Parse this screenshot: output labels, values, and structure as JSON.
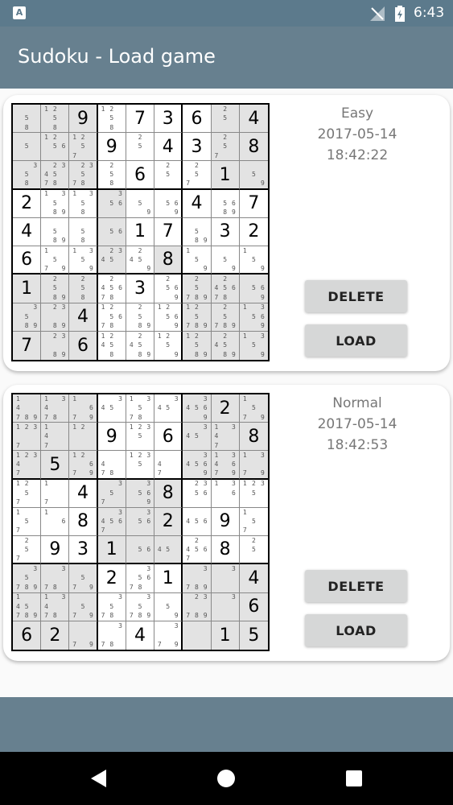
{
  "status_bar": {
    "time": "6:43",
    "notification_icon": "A"
  },
  "app_bar": {
    "title": "Sudoku - Load game"
  },
  "games": [
    {
      "difficulty": "Easy",
      "date": "2017-05-14",
      "time": "18:42:22",
      "delete_label": "DELETE",
      "load_label": "LOAD",
      "grid": [
        [
          "",
          "",
          "9",
          "",
          "7",
          "3",
          "6",
          "",
          "4"
        ],
        [
          "",
          "",
          "",
          "9",
          "",
          "4",
          "3",
          "",
          "8"
        ],
        [
          "",
          "",
          "",
          "",
          "6",
          "",
          "",
          "1",
          ""
        ],
        [
          "2",
          "",
          "",
          "",
          "",
          "",
          "4",
          "",
          "7"
        ],
        [
          "4",
          "",
          "",
          "",
          "1",
          "7",
          "",
          "3",
          "2"
        ],
        [
          "6",
          "",
          "",
          "",
          "",
          "8",
          "",
          "",
          ""
        ],
        [
          "1",
          "",
          "",
          "",
          "3",
          "",
          "",
          "",
          ""
        ],
        [
          "",
          "",
          "4",
          "",
          "",
          "",
          "",
          "",
          ""
        ],
        [
          "7",
          "",
          "6",
          "",
          "",
          "",
          "",
          "",
          ""
        ]
      ],
      "notes": [
        [
          "58",
          "1258",
          "",
          "1258",
          "",
          "",
          "",
          "25",
          ""
        ],
        [
          "5",
          "1256",
          "1257",
          "",
          "25",
          "",
          "",
          "257",
          ""
        ],
        [
          "358",
          "234578",
          "23578",
          "258",
          "",
          "25",
          "257",
          "",
          "59"
        ],
        [
          "",
          "13589",
          "1358",
          "356",
          "59",
          "569",
          "",
          "5689",
          ""
        ],
        [
          "",
          "589",
          "58",
          "56",
          "",
          "",
          "589",
          "",
          ""
        ],
        [
          "",
          "1579",
          "1359",
          "2345",
          "2459",
          "",
          "159",
          "59",
          "159"
        ],
        [
          "",
          "2589",
          "258",
          "245678",
          "",
          "2569",
          "25789",
          "245678",
          "569"
        ],
        [
          "3589",
          "2389",
          "",
          "125678",
          "2589",
          "12569",
          "125789",
          "25789",
          "13569"
        ],
        [
          "",
          "2389",
          "",
          "12458",
          "24589",
          "1259",
          "12589",
          "24589",
          "1359"
        ]
      ],
      "shaded": [
        [
          1,
          1,
          1,
          0,
          0,
          0,
          0,
          1,
          1
        ],
        [
          1,
          1,
          1,
          0,
          0,
          0,
          0,
          1,
          1
        ],
        [
          1,
          1,
          1,
          0,
          0,
          0,
          0,
          1,
          1
        ],
        [
          0,
          0,
          0,
          1,
          0,
          0,
          0,
          0,
          0
        ],
        [
          0,
          0,
          0,
          1,
          0,
          0,
          0,
          0,
          0
        ],
        [
          0,
          0,
          0,
          1,
          0,
          1,
          0,
          0,
          0
        ],
        [
          1,
          1,
          1,
          0,
          0,
          0,
          1,
          1,
          1
        ],
        [
          1,
          1,
          1,
          0,
          0,
          0,
          1,
          1,
          1
        ],
        [
          1,
          1,
          1,
          0,
          0,
          0,
          1,
          1,
          1
        ]
      ]
    },
    {
      "difficulty": "Normal",
      "date": "2017-05-14",
      "time": "18:42:53",
      "delete_label": "DELETE",
      "load_label": "LOAD",
      "grid": [
        [
          "",
          "",
          "",
          "",
          "",
          "",
          "",
          "2",
          ""
        ],
        [
          "",
          "",
          "",
          "9",
          "",
          "6",
          "",
          "",
          "8"
        ],
        [
          "",
          "5",
          "",
          "",
          "",
          "",
          "",
          "",
          ""
        ],
        [
          "",
          "",
          "4",
          "",
          "",
          "8",
          "",
          "",
          ""
        ],
        [
          "",
          "",
          "8",
          "",
          "",
          "2",
          "",
          "9",
          ""
        ],
        [
          "",
          "9",
          "3",
          "1",
          "",
          "",
          "",
          "8",
          ""
        ],
        [
          "",
          "",
          "",
          "2",
          "",
          "1",
          "",
          "",
          "4"
        ],
        [
          "",
          "",
          "",
          "",
          "",
          "",
          "",
          "",
          "6"
        ],
        [
          "6",
          "2",
          "",
          "",
          "4",
          "",
          "",
          "1",
          "5"
        ]
      ],
      "notes": [
        [
          "14789",
          "13478",
          "1679",
          "345",
          "13578",
          "345",
          "34569",
          "",
          "1579"
        ],
        [
          "1237",
          "147",
          "12",
          "",
          "1235",
          "",
          "345",
          "1347",
          ""
        ],
        [
          "12347",
          "",
          "12679",
          "478",
          "1235",
          "47",
          "34569",
          "134679",
          "1379"
        ],
        [
          "1257",
          "17",
          "",
          "357",
          "3569",
          "",
          "2356",
          "136",
          "1235"
        ],
        [
          "157",
          "16",
          "",
          "34567",
          "356",
          "",
          "456",
          "",
          "157"
        ],
        [
          "257",
          "",
          "",
          "",
          "56",
          "45",
          "24567",
          "",
          "25"
        ],
        [
          "35789",
          "378",
          "579",
          "",
          "35678",
          "",
          "37897",
          "3",
          ""
        ],
        [
          "145789",
          "13478",
          "579",
          "3578",
          "35789",
          "59",
          "23789",
          "3",
          ""
        ],
        [
          "",
          "",
          "79",
          "378",
          "",
          "379",
          "",
          "",
          "379"
        ]
      ],
      "shaded": [
        [
          1,
          1,
          1,
          0,
          0,
          0,
          1,
          1,
          1
        ],
        [
          1,
          1,
          1,
          0,
          0,
          0,
          1,
          1,
          1
        ],
        [
          1,
          1,
          1,
          0,
          0,
          0,
          1,
          1,
          1
        ],
        [
          0,
          0,
          0,
          1,
          1,
          1,
          0,
          0,
          0
        ],
        [
          0,
          0,
          0,
          1,
          1,
          1,
          0,
          0,
          0
        ],
        [
          0,
          0,
          0,
          1,
          1,
          1,
          0,
          0,
          0
        ],
        [
          1,
          1,
          1,
          0,
          0,
          0,
          1,
          1,
          1
        ],
        [
          1,
          1,
          1,
          0,
          0,
          0,
          1,
          1,
          1
        ],
        [
          1,
          1,
          1,
          0,
          0,
          0,
          1,
          1,
          1
        ]
      ]
    }
  ]
}
